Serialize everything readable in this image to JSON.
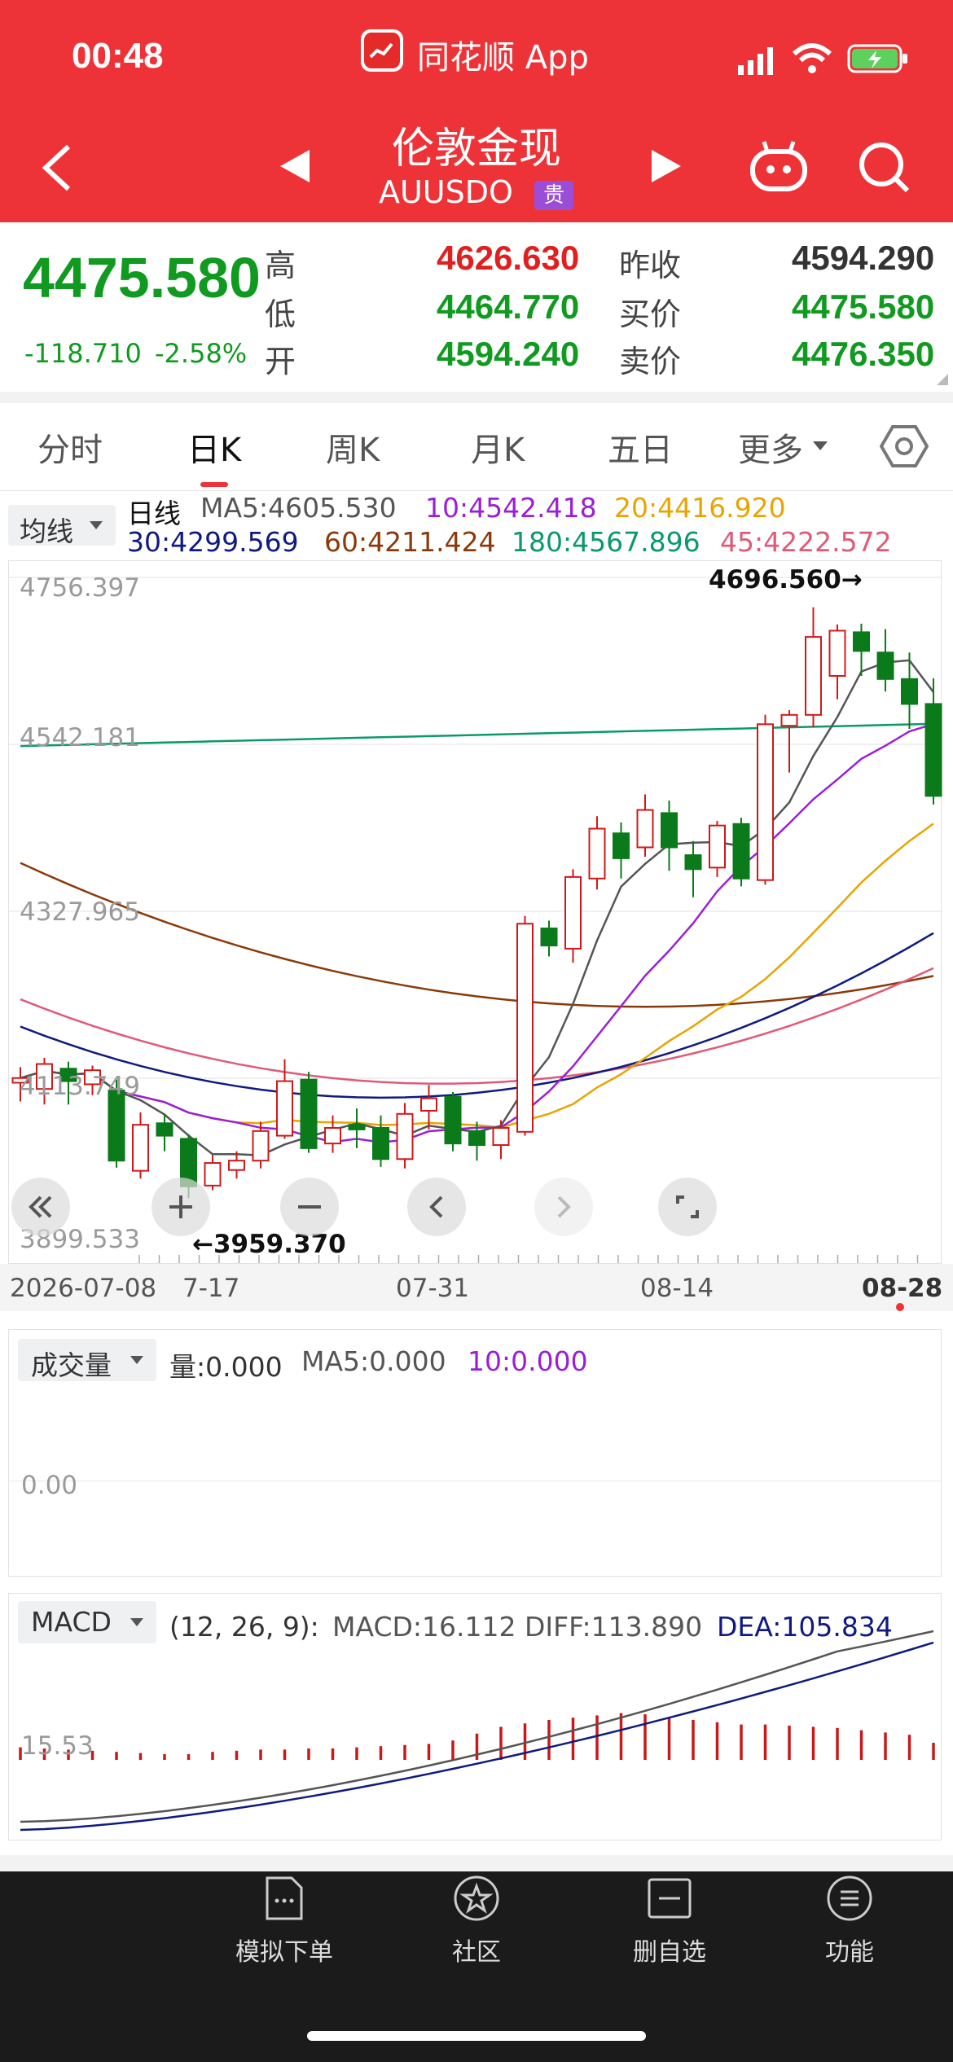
{
  "status_bar": {
    "time": "00:48",
    "app_name": "同花顺 App"
  },
  "nav": {
    "title": "伦敦金现",
    "code": "AUUSDO",
    "badge": "贵"
  },
  "quote": {
    "last": "4475.580",
    "change": "-118.710",
    "change_pct": "-2.58%",
    "high_label": "高",
    "high": "4626.630",
    "low_label": "低",
    "low": "4464.770",
    "open_label": "开",
    "open": "4594.240",
    "prev_close_label": "昨收",
    "prev_close": "4594.290",
    "bid_label": "买价",
    "bid": "4475.580",
    "ask_label": "卖价",
    "ask": "4476.350"
  },
  "tabs": [
    {
      "label": "分时"
    },
    {
      "label": "日K"
    },
    {
      "label": "周K"
    },
    {
      "label": "月K"
    },
    {
      "label": "五日"
    },
    {
      "label": "更多"
    }
  ],
  "ma_legend": {
    "selector": "均线",
    "period": "日线",
    "ma5": "MA5:4605.530",
    "ma10": "10:4542.418",
    "ma20": "20:4416.920",
    "ma30": "30:4299.569",
    "ma60": "60:4211.424",
    "ma180": "180:4567.896",
    "ma45": "45:4222.572"
  },
  "kline": {
    "y_labels": [
      "4756.397",
      "4542.181",
      "4327.965",
      "4113.749",
      "3899.533"
    ],
    "max_marker": "4696.560→",
    "min_marker": "←3959.370",
    "x_labels": [
      "2026-07-08",
      "7-17",
      "07-31",
      "08-14",
      "08-28"
    ]
  },
  "colors": {
    "up": "#d01818",
    "down": "#0a7a1a",
    "brand": "#ee3338",
    "ma5": "#555555",
    "ma10": "#9b1fd6",
    "ma20": "#e8a400",
    "ma30": "#101a80",
    "ma60": "#8a3a0a",
    "ma180": "#0a9a6a",
    "ma45": "#e05a78"
  },
  "volume": {
    "selector": "成交量",
    "vol": "量:0.000",
    "ma5": "MA5:0.000",
    "ma10": "10:0.000",
    "y_label": "0.00"
  },
  "macd": {
    "selector": "MACD",
    "params": "(12, 26, 9):",
    "macd": "MACD:16.112",
    "diff": "DIFF:113.890",
    "dea": "DEA:105.834",
    "y_label": "15.53"
  },
  "footer": [
    {
      "label": "模拟下单",
      "icon": "order-icon"
    },
    {
      "label": "社区",
      "icon": "community-icon"
    },
    {
      "label": "删自选",
      "icon": "remove-watchlist-icon"
    },
    {
      "label": "功能",
      "icon": "menu-icon"
    }
  ],
  "chart_data": {
    "type": "candlestick",
    "title": "伦敦金现 日K",
    "y_range": [
      3899.533,
      4756.397
    ],
    "candles_ohlc": [
      [
        4108,
        4114,
        4084,
        4128
      ],
      [
        4100,
        4132,
        4080,
        4140
      ],
      [
        4126,
        4110,
        4080,
        4135
      ],
      [
        4106,
        4124,
        4092,
        4130
      ],
      [
        4098,
        4008,
        3999,
        4112
      ],
      [
        3995,
        4054,
        3985,
        4070
      ],
      [
        4056,
        4040,
        4020,
        4068
      ],
      [
        4036,
        3975,
        3960,
        4042
      ],
      [
        3976,
        4005,
        3970,
        4015
      ],
      [
        3996,
        4008,
        3985,
        4020
      ],
      [
        4008,
        4046,
        3998,
        4058
      ],
      [
        4040,
        4110,
        4036,
        4138
      ],
      [
        4112,
        4024,
        4018,
        4122
      ],
      [
        4030,
        4050,
        4018,
        4066
      ],
      [
        4054,
        4048,
        4024,
        4075
      ],
      [
        4050,
        4010,
        4000,
        4066
      ],
      [
        4010,
        4068,
        3998,
        4082
      ],
      [
        4072,
        4088,
        4048,
        4105
      ],
      [
        4090,
        4030,
        4020,
        4096
      ],
      [
        4046,
        4028,
        4008,
        4058
      ],
      [
        4028,
        4050,
        4010,
        4060
      ],
      [
        4045,
        4312,
        4040,
        4322
      ],
      [
        4306,
        4284,
        4270,
        4316
      ],
      [
        4280,
        4372,
        4262,
        4382
      ],
      [
        4370,
        4434,
        4356,
        4450
      ],
      [
        4428,
        4396,
        4370,
        4442
      ],
      [
        4410,
        4458,
        4398,
        4478
      ],
      [
        4454,
        4410,
        4380,
        4470
      ],
      [
        4400,
        4382,
        4346,
        4418
      ],
      [
        4384,
        4438,
        4372,
        4444
      ],
      [
        4440,
        4370,
        4360,
        4448
      ],
      [
        4368,
        4568,
        4362,
        4580
      ],
      [
        4566,
        4580,
        4506,
        4586
      ],
      [
        4580,
        4680,
        4564,
        4718
      ],
      [
        4630,
        4688,
        4600,
        4696
      ],
      [
        4686,
        4662,
        4630,
        4697
      ],
      [
        4660,
        4626,
        4610,
        4690
      ],
      [
        4626,
        4594,
        4562,
        4660
      ],
      [
        4594,
        4476,
        4465,
        4627
      ]
    ]
  }
}
